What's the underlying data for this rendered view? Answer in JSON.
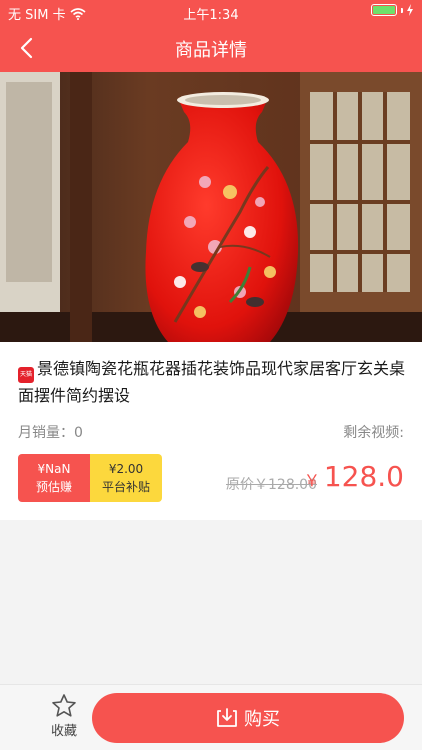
{
  "status_bar": {
    "carrier": "无 SIM 卡",
    "time": "上午1:34"
  },
  "nav": {
    "title": "商品详情"
  },
  "product": {
    "title": "景德镇陶瓷花瓶花器插花装饰品现代家居客厅玄关桌面摆件简约摆设",
    "tmall_badge": "天猫",
    "monthly_sales": "月销量：0",
    "remaining": "剩余视频:",
    "coupon_estimate_amount": "¥NaN",
    "coupon_estimate_label": "预估赚",
    "coupon_subsidy_amount": "¥2.00",
    "coupon_subsidy_label": "平台补贴",
    "original_price": "原价￥128.00",
    "price_symbol": "￥",
    "price": "128.0"
  },
  "bottom": {
    "favorite_label": "收藏",
    "buy_label": "购买"
  },
  "colors": {
    "brand": "#f6534f",
    "subsidy": "#fcd83d"
  }
}
